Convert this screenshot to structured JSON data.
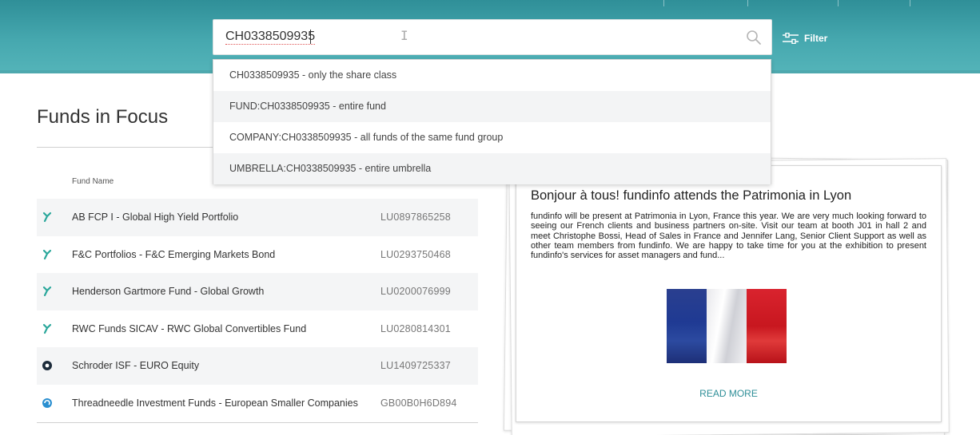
{
  "search": {
    "value": "CH0338509935",
    "filter_label": "Filter",
    "suggestions": [
      "CH0338509935 - only the share class",
      "FUND:CH0338509935 - entire fund",
      "COMPANY:CH0338509935 - all funds of the same fund group",
      "UMBRELLA:CH0338509935 - entire umbrella"
    ]
  },
  "funds_section": {
    "title": "Funds in Focus",
    "column_fund_name": "Fund Name",
    "rows": [
      {
        "name": "AB FCP I - Global High Yield Portfolio",
        "isin": "LU0897865258",
        "icon": "ab-logo-icon"
      },
      {
        "name": "F&C Portfolios - F&C Emerging Markets Bond",
        "isin": "LU0293750468",
        "icon": "fc-logo-icon"
      },
      {
        "name": "Henderson Gartmore Fund - Global Growth",
        "isin": "LU0200076999",
        "icon": "henderson-logo-icon"
      },
      {
        "name": "RWC Funds SICAV - RWC Global Convertibles Fund",
        "isin": "LU0280814301",
        "icon": "rwc-logo-icon"
      },
      {
        "name": "Schroder ISF - EURO Equity",
        "isin": "LU1409725337",
        "icon": "schroder-logo-icon"
      },
      {
        "name": "Threadneedle Investment Funds - European Smaller Companies",
        "isin": "GB00B0H6D894",
        "icon": "threadneedle-logo-icon"
      }
    ]
  },
  "news": {
    "title": "Bonjour à tous! fundinfo attends the Patrimonia in Lyon",
    "body": "fundinfo will be present at Patrimonia in Lyon, France this year. We are very much looking forward to seeing our French clients and business partners on-site. Visit our team at booth J01 in hall 2 and meet Christophe Bossi, Head of Sales in France and Jennifer Lang, Senior Client Support as well as other team members from fundinfo. We are happy to take time for you at the exhibition to present fundinfo's services for asset managers and fund...",
    "image": "french-flag-image",
    "read_more": "READ MORE"
  },
  "colors": {
    "header_teal": "#46a8af",
    "accent": "#2f8f98"
  }
}
